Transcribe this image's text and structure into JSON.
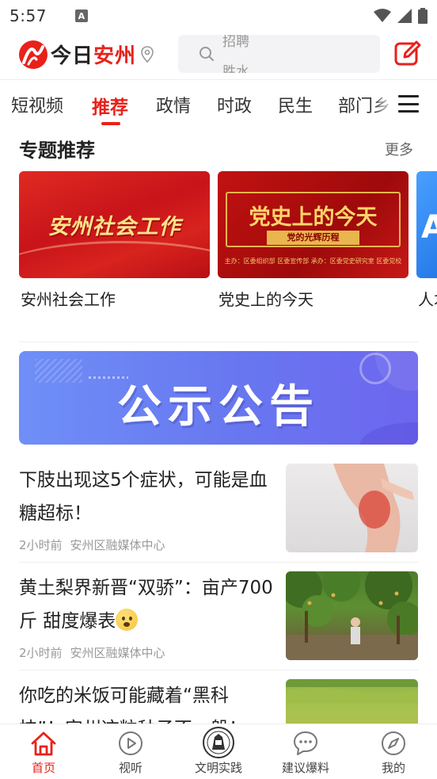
{
  "status_bar": {
    "time": "5:57",
    "notification_letter": "A",
    "icons": [
      "wifi-icon",
      "signal-icon",
      "battery-icon"
    ]
  },
  "header": {
    "logo_text_black": "今日",
    "logo_text_red": "安州",
    "search_placeholder_line1": "招聘",
    "search_placeholder_line2": "胜水",
    "brand_color": "#e8211b"
  },
  "tabs": [
    {
      "label": "短视频",
      "active": false
    },
    {
      "label": "推荐",
      "active": true
    },
    {
      "label": "政情",
      "active": false
    },
    {
      "label": "时政",
      "active": false
    },
    {
      "label": "民生",
      "active": false
    },
    {
      "label": "部门乡",
      "active": false
    }
  ],
  "topics": {
    "title": "专题推荐",
    "more": "更多",
    "cards": [
      {
        "label": "安州社会工作",
        "image_text": "安州社会工作"
      },
      {
        "label": "党史上的今天",
        "image_text": "党史上的今天",
        "image_subtext": "党的光辉历程",
        "image_footer": "主办：区委组织部  区委宣传部  承办：区委党史研究室  区委党校"
      },
      {
        "label": "人才",
        "image_text": "A"
      }
    ]
  },
  "banner": {
    "text": "公示公告",
    "gradient_start": "#6f8ff7",
    "gradient_end": "#6d66ee"
  },
  "news": [
    {
      "title": "下肢出现这5个症状，可能是血糖超标！",
      "time": "2小时前",
      "source": "安州区融媒体中心"
    },
    {
      "title": "黄土梨界新晋“双骄”：亩产700斤 甜度爆表",
      "time": "2小时前",
      "source": "安州区融媒体中心"
    },
    {
      "title": "你吃的米饭可能藏着“黑科技”！安州这粒种子不一般！",
      "time": "",
      "source": ""
    }
  ],
  "bottom_nav": [
    {
      "label": "首页",
      "icon": "home-icon",
      "active": true
    },
    {
      "label": "视听",
      "icon": "play-icon",
      "active": false
    },
    {
      "label": "文明实践",
      "icon": "emblem-icon",
      "active": false
    },
    {
      "label": "建议爆料",
      "icon": "chat-icon",
      "active": false
    },
    {
      "label": "我的",
      "icon": "compass-icon",
      "active": false
    }
  ]
}
